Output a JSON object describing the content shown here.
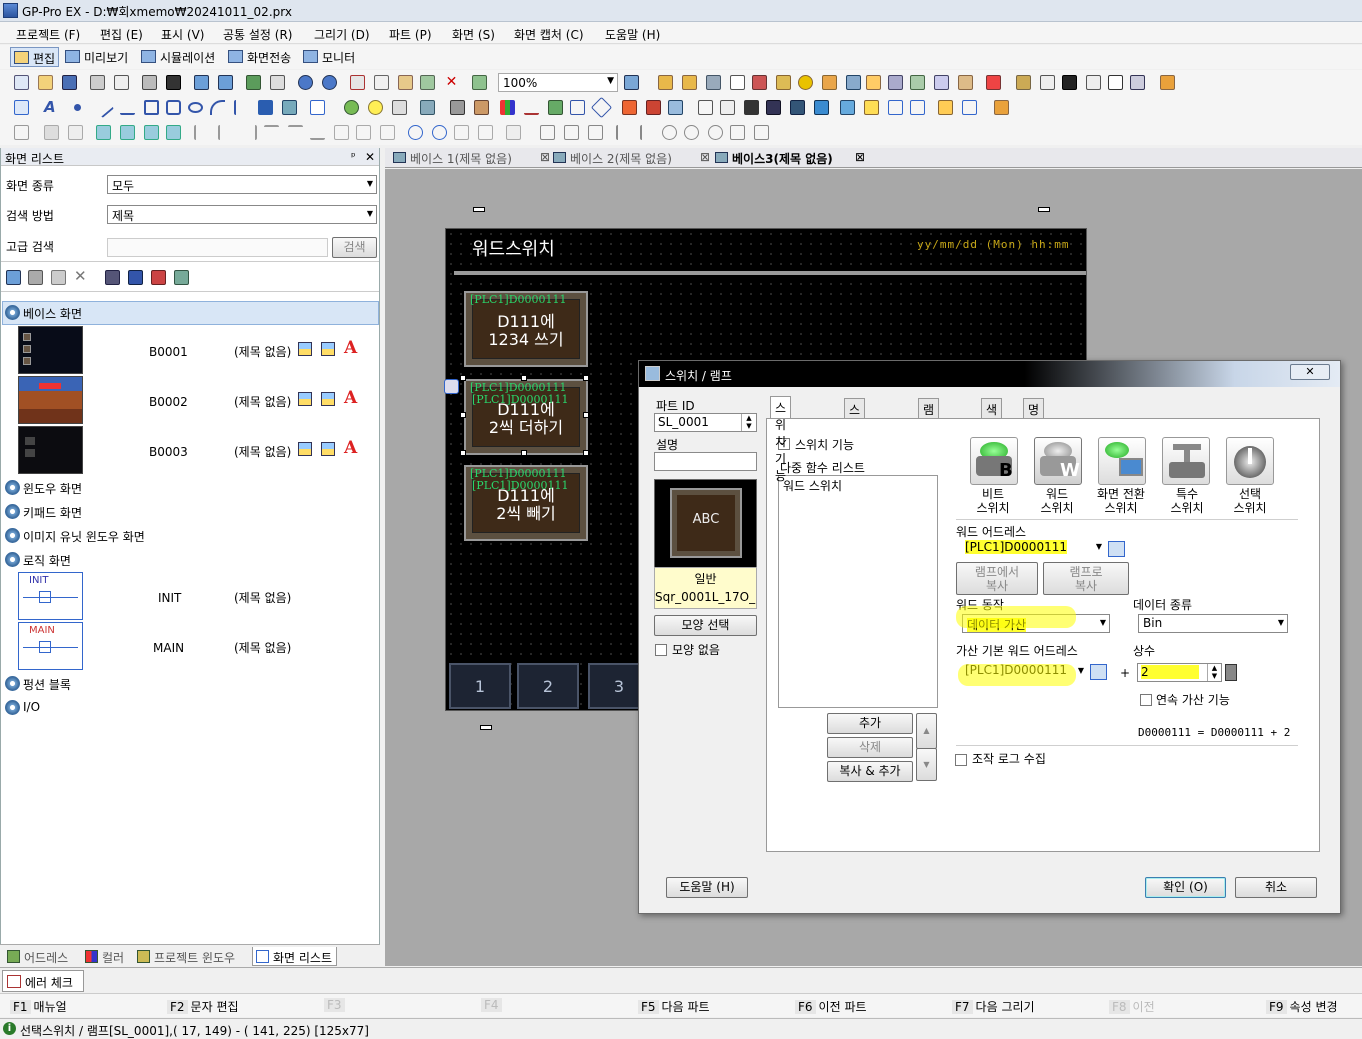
{
  "app": {
    "title": "GP-Pro EX - D:₩회xmemo₩20241011_02.prx"
  },
  "menu": [
    "프로젝트 (F)",
    "편집 (E)",
    "표시 (V)",
    "공통 설정 (R)",
    "그리기 (D)",
    "파트 (P)",
    "화면 (S)",
    "화면 캡처 (C)",
    "도움말 (H)"
  ],
  "modes": [
    "편집",
    "미리보기",
    "시뮬레이션",
    "화면전송",
    "모니터"
  ],
  "toolbar": {
    "zoom": "100%"
  },
  "left_panel": {
    "title": "화면 리스트",
    "pin": "ᅟ ᅟ ",
    "screen_type_label": "화면 종류",
    "screen_type_value": "모두",
    "search_method_label": "검색 방법",
    "search_method_value": "제목",
    "advanced_search_label": "고급 검색",
    "search_button": "검색",
    "base_screens": "베이스 화면",
    "base_rows": [
      {
        "id": "B0001",
        "title": "(제목 없음)"
      },
      {
        "id": "B0002",
        "title": "(제목 없음)"
      },
      {
        "id": "B0003",
        "title": "(제목 없음)"
      }
    ],
    "window_screens": "윈도우 화면",
    "keypad_screens": "키패드 화면",
    "image_unit_screens": "이미지 유닛 윈도우 화면",
    "logic_screens": "로직 화면",
    "logic_rows": [
      {
        "thumb": "INIT",
        "id": "INIT",
        "title": "(제목 없음)"
      },
      {
        "thumb": "MAIN",
        "id": "MAIN",
        "title": "(제목 없음)"
      }
    ],
    "function_blocks": "펑션 블록",
    "io": "I/O",
    "tabs": [
      "어드레스",
      "컬러",
      "프로젝트 윈도우",
      "화면 리스트"
    ]
  },
  "editor_tabs": [
    {
      "label": "베이스 1(제목 없음)"
    },
    {
      "label": "베이스 2(제목 없음)"
    },
    {
      "label": "베이스3(제목 없음)"
    }
  ],
  "hmi": {
    "title": "워드스위치",
    "date_time": "yy/mm/dd (Mon) hh:mm",
    "buttons": [
      {
        "tag": "[PLC1]D0000111",
        "tag2": "",
        "text": "D111에\n1234 쓰기"
      },
      {
        "tag": "[PLC1]D0000111",
        "tag2": "[PLC1]D0000111",
        "text": "D111에\n2씩 더하기"
      },
      {
        "tag": "[PLC1]D0000111",
        "tag2": "[PLC1]D0000111",
        "text": "D111에\n2씩 빼기"
      }
    ],
    "nums": [
      "1",
      "2",
      "3"
    ]
  },
  "dialog": {
    "title": "스위치 / 램프",
    "close": "✕",
    "part_id_label": "파트 ID",
    "part_id": "SL_0001",
    "desc_label": "설명",
    "preview_text": "ABC",
    "preview_kind": "일반",
    "preview_name": "Sqr_0001L_17O_...",
    "shape_select": "모양 선택",
    "no_shape": "모양 없음",
    "tabs": [
      "스위치 기능",
      "스위치 공통",
      "램프 기능",
      "색상",
      "명판"
    ],
    "switch_function": "스위치 기능",
    "multi_function_list": "다중 함수 리스트",
    "list_items": [
      "워드 스위치"
    ],
    "add": "추가",
    "delete": "삭제",
    "copy_add": "복사 & 추가",
    "switch_types": [
      {
        "label": "비트\n스위치",
        "letter": "B"
      },
      {
        "label": "워드\n스위치",
        "letter": "W"
      },
      {
        "label": "화면 전환\n스위치",
        "letter": ""
      },
      {
        "label": "특수\n스위치",
        "letter": ""
      },
      {
        "label": "선택\n스위치",
        "letter": ""
      }
    ],
    "word_address_label": "워드 어드레스",
    "word_address": "[PLC1]D0000111",
    "copy_from_lamp": "램프에서\n복사",
    "copy_to_lamp": "램프로\n복사",
    "word_action_label": "워드 동작",
    "word_action": "데이터 가산",
    "data_type_label": "데이터 종류",
    "data_type": "Bin",
    "add_base_label": "가산 기본 워드 어드레스",
    "add_base": "[PLC1]D0000111",
    "plus": "+",
    "constant_label": "상수",
    "constant": "2",
    "continuous_add": "연속 가산 기능",
    "formula": "D0000111 = D0000111 + 2",
    "op_log": "조작 로그 수집",
    "help": "도움말 (H)",
    "ok": "확인 (O)",
    "cancel": "취소"
  },
  "error_check": "에러 체크",
  "fkeys": [
    {
      "k": "F1",
      "l": "매뉴얼",
      "en": true
    },
    {
      "k": "F2",
      "l": "문자 편집",
      "en": true
    },
    {
      "k": "F3",
      "l": "",
      "en": false
    },
    {
      "k": "F4",
      "l": "",
      "en": false
    },
    {
      "k": "F5",
      "l": "다음 파트",
      "en": true
    },
    {
      "k": "F6",
      "l": "이전 파트",
      "en": true
    },
    {
      "k": "F7",
      "l": "다음 그리기",
      "en": true
    },
    {
      "k": "F8",
      "l": "이전",
      "en": false
    },
    {
      "k": "F9",
      "l": "속성 변경",
      "en": true
    }
  ],
  "status": "선택스위치 / 램프[SL_0001],( 17, 149) - ( 141, 225) [125x77]"
}
